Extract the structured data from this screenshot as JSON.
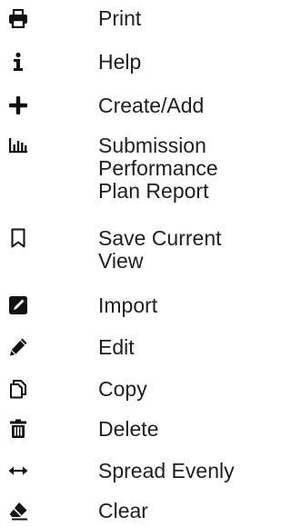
{
  "legend": {
    "items": [
      {
        "icon": "print-icon",
        "label": "Print"
      },
      {
        "icon": "info-icon",
        "label": "Help"
      },
      {
        "icon": "plus-icon",
        "label": "Create/Add"
      },
      {
        "icon": "bar-chart-icon",
        "label": "Submission\nPerformance\nPlan Report"
      },
      {
        "icon": "bookmark-icon",
        "label": "Save Current\nView"
      },
      {
        "icon": "edit-square-icon",
        "label": "Import"
      },
      {
        "icon": "pencil-icon",
        "label": "Edit"
      },
      {
        "icon": "copy-icon",
        "label": "Copy"
      },
      {
        "icon": "trash-icon",
        "label": "Delete"
      },
      {
        "icon": "horizontal-arrows-icon",
        "label": "Spread Evenly"
      },
      {
        "icon": "eraser-icon",
        "label": "Clear"
      }
    ]
  }
}
